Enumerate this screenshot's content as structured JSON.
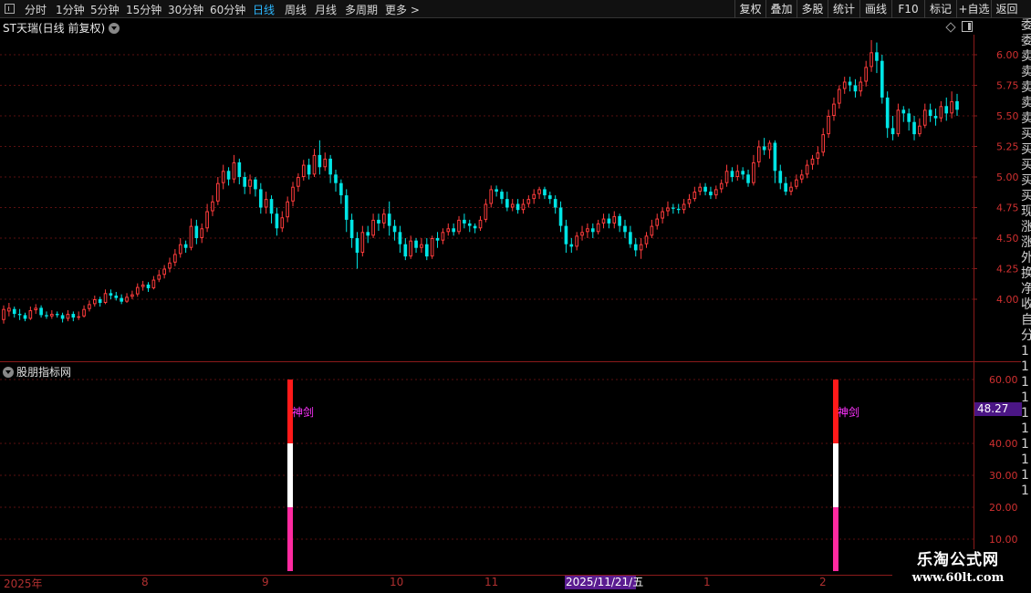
{
  "toolbar": {
    "periods": [
      "分时",
      "1分钟",
      "5分钟",
      "15分钟",
      "30分钟",
      "60分钟",
      "日线",
      "周线",
      "月线",
      "多周期",
      "更多 >"
    ],
    "active_period": "日线",
    "right_tools": [
      "复权",
      "叠加",
      "多股",
      "统计",
      "画线",
      "F10",
      "标记",
      "+自选",
      "返回"
    ]
  },
  "stock": {
    "name": "ST天瑞",
    "mode": "(日线 前复权)"
  },
  "indicator": {
    "name": "股朋指标网",
    "signal_label": "神剑",
    "current_value": "48.27"
  },
  "price_axis": {
    "ticks": [
      "6.00",
      "5.75",
      "5.50",
      "5.25",
      "5.00",
      "4.75",
      "4.50",
      "4.25",
      "4.00"
    ]
  },
  "indicator_axis": {
    "ticks": [
      "60.00",
      "40.00",
      "30.00",
      "20.00",
      "10.00"
    ]
  },
  "time_axis": {
    "labels": [
      "2025年",
      "8",
      "9",
      "10",
      "11",
      "1",
      "2"
    ],
    "highlight_date": "2025/11/21/五"
  },
  "right_strip": {
    "chars": [
      "委",
      "委",
      "卖",
      "卖",
      "卖",
      "卖",
      "卖",
      "买",
      "买",
      "买",
      "买",
      "买",
      "现",
      "涨",
      "涨",
      "外",
      "换",
      "净",
      "收",
      "自",
      "分",
      "1",
      "1",
      "1",
      "1",
      "1",
      "1",
      "1",
      "1",
      "1",
      "1"
    ]
  },
  "watermark": {
    "title": "乐淘公式网",
    "url": "www.60lt.com"
  },
  "colors": {
    "up": "#ff3c3c",
    "down": "#00e5e5",
    "grid": "#5a1010",
    "signal_top": "#ff1a1a",
    "signal_mid": "#ffffff",
    "signal_bottom": "#ff2aa0",
    "signal_text": "#ff33ff",
    "active_period": "#2cb8ff"
  },
  "chart_data": {
    "type": "candlestick",
    "price_range": [
      3.7,
      6.15
    ],
    "indicator_range": [
      0,
      65
    ],
    "signals": [
      {
        "date_index": 80,
        "value": 60
      },
      {
        "date_index": 230,
        "value": 60
      }
    ],
    "candles": [
      [
        3.83,
        3.92,
        3.8,
        3.95
      ],
      [
        3.9,
        3.93,
        3.86,
        3.97
      ],
      [
        3.92,
        3.88,
        3.85,
        3.94
      ],
      [
        3.88,
        3.87,
        3.83,
        3.92
      ],
      [
        3.87,
        3.84,
        3.82,
        3.89
      ],
      [
        3.84,
        3.91,
        3.83,
        3.94
      ],
      [
        3.91,
        3.93,
        3.88,
        3.96
      ],
      [
        3.93,
        3.87,
        3.85,
        3.95
      ],
      [
        3.87,
        3.86,
        3.84,
        3.9
      ],
      [
        3.86,
        3.88,
        3.84,
        3.91
      ],
      [
        3.88,
        3.87,
        3.85,
        3.9
      ],
      [
        3.87,
        3.84,
        3.81,
        3.89
      ],
      [
        3.84,
        3.88,
        3.82,
        3.91
      ],
      [
        3.88,
        3.85,
        3.82,
        3.9
      ],
      [
        3.85,
        3.86,
        3.83,
        3.9
      ],
      [
        3.86,
        3.92,
        3.85,
        3.95
      ],
      [
        3.92,
        3.96,
        3.9,
        3.99
      ],
      [
        3.96,
        4.0,
        3.94,
        4.03
      ],
      [
        4.0,
        3.97,
        3.94,
        4.02
      ],
      [
        3.97,
        4.05,
        3.96,
        4.08
      ],
      [
        4.05,
        4.03,
        4.0,
        4.08
      ],
      [
        4.03,
        4.01,
        3.99,
        4.06
      ],
      [
        4.01,
        3.98,
        3.96,
        4.04
      ],
      [
        3.98,
        4.02,
        3.97,
        4.05
      ],
      [
        4.02,
        4.04,
        4.0,
        4.07
      ],
      [
        4.04,
        4.1,
        4.02,
        4.13
      ],
      [
        4.1,
        4.12,
        4.07,
        4.15
      ],
      [
        4.12,
        4.09,
        4.06,
        4.14
      ],
      [
        4.09,
        4.16,
        4.08,
        4.19
      ],
      [
        4.16,
        4.2,
        4.14,
        4.24
      ],
      [
        4.2,
        4.25,
        4.17,
        4.28
      ],
      [
        4.25,
        4.3,
        4.22,
        4.34
      ],
      [
        4.3,
        4.37,
        4.27,
        4.41
      ],
      [
        4.37,
        4.45,
        4.34,
        4.5
      ],
      [
        4.45,
        4.42,
        4.38,
        4.48
      ],
      [
        4.42,
        4.6,
        4.4,
        4.66
      ],
      [
        4.6,
        4.5,
        4.45,
        4.65
      ],
      [
        4.5,
        4.58,
        4.46,
        4.62
      ],
      [
        4.58,
        4.72,
        4.55,
        4.78
      ],
      [
        4.72,
        4.8,
        4.68,
        4.85
      ],
      [
        4.8,
        4.95,
        4.77,
        5.0
      ],
      [
        4.95,
        5.05,
        4.9,
        5.1
      ],
      [
        5.05,
        4.98,
        4.93,
        5.08
      ],
      [
        4.98,
        5.12,
        4.95,
        5.18
      ],
      [
        5.12,
        5.0,
        4.94,
        5.15
      ],
      [
        5.0,
        4.92,
        4.86,
        5.04
      ],
      [
        4.92,
        4.98,
        4.86,
        5.02
      ],
      [
        4.98,
        4.9,
        4.84,
        5.0
      ],
      [
        4.9,
        4.75,
        4.7,
        4.95
      ],
      [
        4.75,
        4.82,
        4.7,
        4.88
      ],
      [
        4.82,
        4.7,
        4.62,
        4.85
      ],
      [
        4.7,
        4.58,
        4.52,
        4.75
      ],
      [
        4.58,
        4.67,
        4.55,
        4.72
      ],
      [
        4.67,
        4.8,
        4.63,
        4.84
      ],
      [
        4.8,
        4.92,
        4.76,
        4.96
      ],
      [
        4.92,
        5.0,
        4.88,
        5.03
      ],
      [
        5.0,
        5.1,
        4.97,
        5.14
      ],
      [
        5.1,
        5.02,
        4.98,
        5.15
      ],
      [
        5.02,
        5.18,
        5.0,
        5.23
      ],
      [
        5.18,
        5.08,
        5.02,
        5.3
      ],
      [
        5.08,
        5.15,
        5.05,
        5.2
      ],
      [
        5.15,
        5.02,
        4.95,
        5.18
      ],
      [
        5.02,
        4.95,
        4.88,
        5.06
      ],
      [
        4.95,
        4.85,
        4.78,
        4.98
      ],
      [
        4.85,
        4.65,
        4.55,
        4.9
      ],
      [
        4.65,
        4.5,
        4.42,
        4.7
      ],
      [
        4.5,
        4.38,
        4.25,
        4.55
      ],
      [
        4.38,
        4.55,
        4.35,
        4.6
      ],
      [
        4.55,
        4.52,
        4.46,
        4.6
      ],
      [
        4.52,
        4.65,
        4.5,
        4.7
      ],
      [
        4.65,
        4.62,
        4.56,
        4.7
      ],
      [
        4.62,
        4.7,
        4.58,
        4.74
      ],
      [
        4.7,
        4.6,
        4.52,
        4.8
      ],
      [
        4.6,
        4.55,
        4.48,
        4.65
      ],
      [
        4.55,
        4.45,
        4.38,
        4.6
      ],
      [
        4.45,
        4.35,
        4.32,
        4.5
      ],
      [
        4.35,
        4.48,
        4.33,
        4.52
      ],
      [
        4.48,
        4.42,
        4.38,
        4.5
      ],
      [
        4.42,
        4.45,
        4.38,
        4.5
      ],
      [
        4.45,
        4.35,
        4.32,
        4.5
      ],
      [
        4.35,
        4.5,
        4.33,
        4.52
      ],
      [
        4.5,
        4.48,
        4.42,
        4.55
      ],
      [
        4.48,
        4.55,
        4.45,
        4.58
      ],
      [
        4.55,
        4.58,
        4.52,
        4.62
      ],
      [
        4.58,
        4.55,
        4.52,
        4.62
      ],
      [
        4.55,
        4.65,
        4.53,
        4.68
      ],
      [
        4.65,
        4.62,
        4.58,
        4.7
      ],
      [
        4.62,
        4.6,
        4.55,
        4.65
      ],
      [
        4.6,
        4.58,
        4.54,
        4.62
      ],
      [
        4.58,
        4.65,
        4.56,
        4.68
      ],
      [
        4.65,
        4.78,
        4.63,
        4.82
      ],
      [
        4.78,
        4.9,
        4.75,
        4.93
      ],
      [
        4.9,
        4.88,
        4.84,
        4.93
      ],
      [
        4.88,
        4.82,
        4.78,
        4.9
      ],
      [
        4.82,
        4.75,
        4.72,
        4.88
      ],
      [
        4.75,
        4.78,
        4.72,
        4.82
      ],
      [
        4.78,
        4.73,
        4.7,
        4.82
      ],
      [
        4.73,
        4.78,
        4.7,
        4.82
      ],
      [
        4.78,
        4.82,
        4.75,
        4.85
      ],
      [
        4.82,
        4.86,
        4.78,
        4.9
      ],
      [
        4.86,
        4.9,
        4.82,
        4.92
      ],
      [
        4.9,
        4.85,
        4.82,
        4.92
      ],
      [
        4.85,
        4.82,
        4.78,
        4.88
      ],
      [
        4.82,
        4.75,
        4.7,
        4.85
      ],
      [
        4.75,
        4.6,
        4.55,
        4.8
      ],
      [
        4.6,
        4.45,
        4.38,
        4.65
      ],
      [
        4.45,
        4.43,
        4.38,
        4.5
      ],
      [
        4.43,
        4.52,
        4.4,
        4.55
      ],
      [
        4.52,
        4.55,
        4.48,
        4.6
      ],
      [
        4.55,
        4.58,
        4.5,
        4.62
      ],
      [
        4.58,
        4.55,
        4.5,
        4.62
      ],
      [
        4.55,
        4.62,
        4.53,
        4.65
      ],
      [
        4.62,
        4.66,
        4.58,
        4.7
      ],
      [
        4.66,
        4.62,
        4.58,
        4.7
      ],
      [
        4.62,
        4.68,
        4.58,
        4.72
      ],
      [
        4.68,
        4.6,
        4.55,
        4.7
      ],
      [
        4.6,
        4.55,
        4.5,
        4.65
      ],
      [
        4.55,
        4.45,
        4.42,
        4.6
      ],
      [
        4.45,
        4.4,
        4.35,
        4.5
      ],
      [
        4.4,
        4.45,
        4.33,
        4.5
      ],
      [
        4.45,
        4.52,
        4.42,
        4.55
      ],
      [
        4.52,
        4.6,
        4.5,
        4.65
      ],
      [
        4.6,
        4.66,
        4.57,
        4.7
      ],
      [
        4.66,
        4.72,
        4.62,
        4.75
      ],
      [
        4.72,
        4.75,
        4.68,
        4.8
      ],
      [
        4.75,
        4.74,
        4.7,
        4.78
      ],
      [
        4.74,
        4.73,
        4.7,
        4.78
      ],
      [
        4.73,
        4.78,
        4.7,
        4.82
      ],
      [
        4.78,
        4.82,
        4.75,
        4.86
      ],
      [
        4.82,
        4.88,
        4.8,
        4.92
      ],
      [
        4.88,
        4.92,
        4.85,
        4.95
      ],
      [
        4.92,
        4.88,
        4.85,
        4.95
      ],
      [
        4.88,
        4.85,
        4.82,
        4.92
      ],
      [
        4.85,
        4.9,
        4.82,
        4.93
      ],
      [
        4.9,
        4.95,
        4.87,
        4.98
      ],
      [
        4.95,
        5.05,
        4.92,
        5.1
      ],
      [
        5.05,
        5.0,
        4.96,
        5.08
      ],
      [
        5.0,
        5.05,
        4.97,
        5.1
      ],
      [
        5.05,
        5.02,
        4.98,
        5.08
      ],
      [
        5.02,
        4.95,
        4.92,
        5.06
      ],
      [
        4.95,
        5.12,
        4.93,
        5.18
      ],
      [
        5.12,
        5.25,
        5.08,
        5.3
      ],
      [
        5.25,
        5.22,
        5.18,
        5.32
      ],
      [
        5.22,
        5.28,
        5.15,
        5.3
      ],
      [
        5.28,
        5.05,
        4.95,
        5.3
      ],
      [
        5.05,
        4.95,
        4.9,
        5.1
      ],
      [
        4.95,
        4.88,
        4.85,
        5.0
      ],
      [
        4.88,
        4.92,
        4.85,
        4.96
      ],
      [
        4.92,
        4.98,
        4.9,
        5.02
      ],
      [
        4.98,
        5.02,
        4.95,
        5.06
      ],
      [
        5.02,
        5.1,
        4.99,
        5.14
      ],
      [
        5.1,
        5.15,
        5.06,
        5.18
      ],
      [
        5.15,
        5.2,
        5.1,
        5.25
      ],
      [
        5.2,
        5.35,
        5.17,
        5.4
      ],
      [
        5.35,
        5.5,
        5.32,
        5.55
      ],
      [
        5.5,
        5.6,
        5.46,
        5.65
      ],
      [
        5.6,
        5.72,
        5.56,
        5.75
      ],
      [
        5.72,
        5.78,
        5.68,
        5.82
      ],
      [
        5.78,
        5.75,
        5.7,
        5.82
      ],
      [
        5.75,
        5.7,
        5.65,
        5.8
      ],
      [
        5.7,
        5.78,
        5.66,
        5.82
      ],
      [
        5.78,
        5.9,
        5.74,
        5.95
      ],
      [
        5.9,
        6.02,
        5.86,
        6.12
      ],
      [
        6.02,
        5.95,
        5.85,
        6.1
      ],
      [
        5.95,
        5.65,
        5.6,
        6.0
      ],
      [
        5.65,
        5.4,
        5.32,
        5.7
      ],
      [
        5.4,
        5.35,
        5.3,
        5.5
      ],
      [
        5.35,
        5.55,
        5.33,
        5.6
      ],
      [
        5.55,
        5.52,
        5.45,
        5.58
      ],
      [
        5.52,
        5.45,
        5.38,
        5.56
      ],
      [
        5.45,
        5.35,
        5.3,
        5.5
      ],
      [
        5.35,
        5.42,
        5.33,
        5.48
      ],
      [
        5.42,
        5.55,
        5.4,
        5.6
      ],
      [
        5.55,
        5.5,
        5.45,
        5.6
      ],
      [
        5.5,
        5.48,
        5.42,
        5.56
      ],
      [
        5.48,
        5.58,
        5.45,
        5.62
      ],
      [
        5.58,
        5.52,
        5.46,
        5.65
      ],
      [
        5.52,
        5.62,
        5.48,
        5.7
      ],
      [
        5.62,
        5.55,
        5.5,
        5.68
      ]
    ]
  }
}
